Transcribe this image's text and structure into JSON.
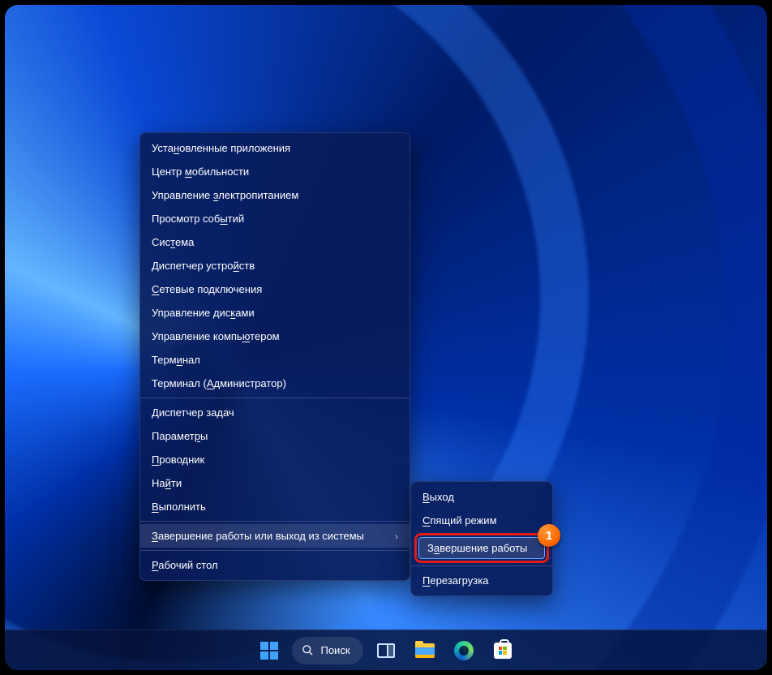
{
  "menu": {
    "groups": [
      [
        {
          "pre": "Уста",
          "u": "н",
          "post": "овленные приложения"
        },
        {
          "pre": "Центр ",
          "u": "м",
          "post": "обильности"
        },
        {
          "pre": "Управление ",
          "u": "э",
          "post": "лектропитанием"
        },
        {
          "pre": "Просмотр соб",
          "u": "ы",
          "post": "тий"
        },
        {
          "pre": "Сис",
          "u": "т",
          "post": "ема"
        },
        {
          "pre": "Диспетчер устро",
          "u": "й",
          "post": "ств"
        },
        {
          "pre": "",
          "u": "С",
          "post": "етевые подключения"
        },
        {
          "pre": "Управление дис",
          "u": "к",
          "post": "ами"
        },
        {
          "pre": "Управление компь",
          "u": "ю",
          "post": "тером"
        },
        {
          "pre": "Терм",
          "u": "и",
          "post": "нал"
        },
        {
          "pre": "Терминал (",
          "u": "А",
          "post": "дминистратор)"
        }
      ],
      [
        {
          "pre": "",
          "u": "Д",
          "post": "испетчер задач"
        },
        {
          "pre": "Парамет",
          "u": "р",
          "post": "ы"
        },
        {
          "pre": "",
          "u": "П",
          "post": "роводник"
        },
        {
          "pre": "На",
          "u": "й",
          "post": "ти"
        },
        {
          "pre": "",
          "u": "В",
          "post": "ыполнить"
        }
      ],
      [
        {
          "pre": "",
          "u": "З",
          "post": "авершение работы или выход из системы",
          "submenu": true,
          "hovered": true
        }
      ],
      [
        {
          "pre": "",
          "u": "Р",
          "post": "абочий стол"
        }
      ]
    ]
  },
  "submenu": {
    "items": [
      {
        "pre": "",
        "u": "В",
        "post": "ыход"
      },
      {
        "pre": "",
        "u": "С",
        "post": "пящий режим"
      }
    ],
    "highlighted": {
      "pre": "З",
      "u": "а",
      "post": "вершение работы"
    },
    "after": [
      {
        "pre": "",
        "u": "П",
        "post": "ерезагрузка"
      }
    ]
  },
  "marker": "1",
  "taskbar": {
    "search": "Поиск"
  }
}
